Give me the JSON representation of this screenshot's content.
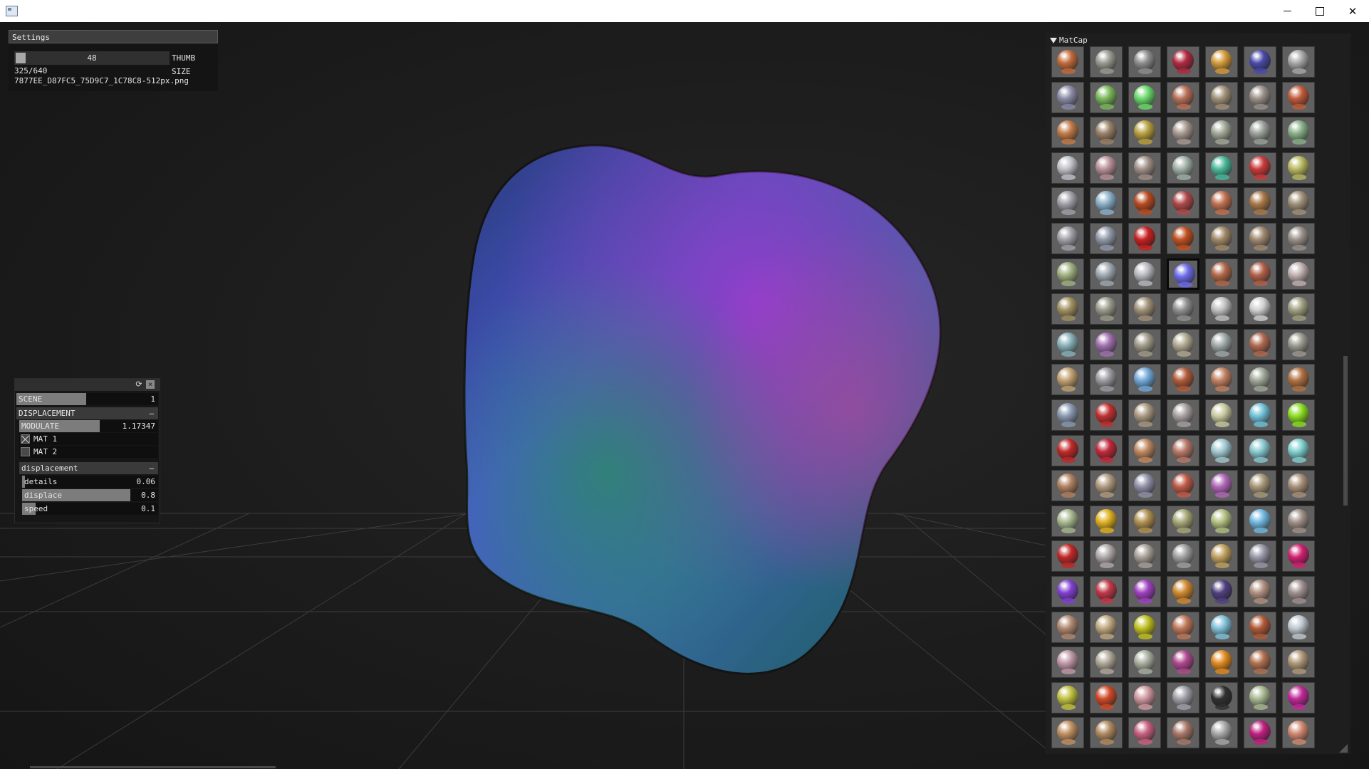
{
  "window": {
    "minimize_icon": "minimize-icon",
    "maximize_icon": "maximize-icon",
    "close_icon": "close-icon"
  },
  "settings": {
    "title": "Settings",
    "thumb_size_value": "48",
    "thumb_size_label": "THUMB SIZE",
    "count": "325/640",
    "filename": "7877EE_D87FC5_75D9C7_1C78C8-512px.png"
  },
  "params": {
    "scene_label": "SCENE",
    "scene_value": "1",
    "displacement_header": "DISPLACEMENT",
    "collapse_symbol": "–",
    "modulate_label": "MODULATE",
    "modulate_value": "1.17347",
    "mat1_label": "MAT 1",
    "mat1_checked": true,
    "mat2_label": "MAT 2",
    "mat2_checked": false,
    "sub_header": "displacement",
    "details_label": "details",
    "details_value": "0.06",
    "displace_label": "displace",
    "displace_value": "0.8",
    "speed_label": "speed",
    "speed_value": "0.1",
    "head_icons": [
      "refresh-icon",
      "close-icon"
    ]
  },
  "matcap": {
    "title": "MatCap",
    "rows": 20,
    "cols": 7,
    "selected_row": 6,
    "selected_col": 3,
    "palette": [
      [
        "#c06a3a",
        "#9a9a92",
        "#8e8e8e",
        "#b02a40",
        "#d49a3a",
        "#4a4aa8",
        "#a8a8a8"
      ],
      [
        "#8a8aa8",
        "#7ab85a",
        "#6ad86a",
        "#b87058",
        "#a09078",
        "#9a9088",
        "#c05a3a"
      ],
      [
        "#c07a48",
        "#9a8068",
        "#b8a040",
        "#a89890",
        "#a0a898",
        "#9aa09a",
        "#88b088"
      ],
      [
        "#c0c0c8",
        "#b89098",
        "#a09088",
        "#a0b0a8",
        "#4ab898",
        "#c83a3a",
        "#b8b860"
      ],
      [
        "#a0a0a8",
        "#8ab0c8",
        "#b84a20",
        "#b04848",
        "#c07050",
        "#a87848",
        "#a09078"
      ],
      [
        "#a0a0a8",
        "#9098a8",
        "#c82020",
        "#c05020",
        "#a08868",
        "#a08870",
        "#9a9088"
      ],
      [
        "#a0b080",
        "#a0a8b0",
        "#b8b8c0",
        "#6a6ae8",
        "#b06848",
        "#b06048",
        "#c0b0b0"
      ],
      [
        "#a09060",
        "#9a9a8a",
        "#a09078",
        "#909090",
        "#c0c0c0",
        "#d0d0d0",
        "#a0a080"
      ],
      [
        "#88b0b8",
        "#a070b0",
        "#a09a88",
        "#b0a890",
        "#a0a8a8",
        "#b06850",
        "#9a9a90"
      ],
      [
        "#c0a070",
        "#9a9aa0",
        "#70a8d8",
        "#b05a3a",
        "#c08060",
        "#a0a898",
        "#b07040"
      ],
      [
        "#8898b0",
        "#c03030",
        "#a89880",
        "#a8a0a0",
        "#c8c8a0",
        "#70c0d8",
        "#8adc20"
      ],
      [
        "#c02828",
        "#c02838",
        "#c08860",
        "#b87868",
        "#a0c8d0",
        "#88c8d0",
        "#80d0d0"
      ],
      [
        "#b08060",
        "#b09a80",
        "#9090a8",
        "#c05a48",
        "#b068b8",
        "#a89878",
        "#a89078"
      ],
      [
        "#a8b890",
        "#e0b020",
        "#b09050",
        "#a8a878",
        "#b0c080",
        "#70b8e0",
        "#a09088"
      ],
      [
        "#c02828",
        "#b0a8a8",
        "#a8a098",
        "#a0a0a0",
        "#c0a060",
        "#9898a8",
        "#d02070"
      ],
      [
        "#8040d0",
        "#c03848",
        "#a040c0",
        "#d08830",
        "#504080",
        "#b09080",
        "#a09090"
      ],
      [
        "#b08870",
        "#c0a880",
        "#c0c020",
        "#c07858",
        "#80c0d8",
        "#b05a38",
        "#c0c8d0"
      ],
      [
        "#c098a8",
        "#b0a898",
        "#a8b0a0",
        "#b04890",
        "#e08a20",
        "#b07050",
        "#b09878"
      ],
      [
        "#c0c040",
        "#d04828",
        "#d098a0",
        "#a0a0a8",
        "#303030",
        "#a8b890",
        "#c02898"
      ],
      [
        "#c09060",
        "#b08a60",
        "#c86080",
        "#a87868",
        "#a8a8a8",
        "#c02080",
        "#d08870"
      ]
    ]
  }
}
